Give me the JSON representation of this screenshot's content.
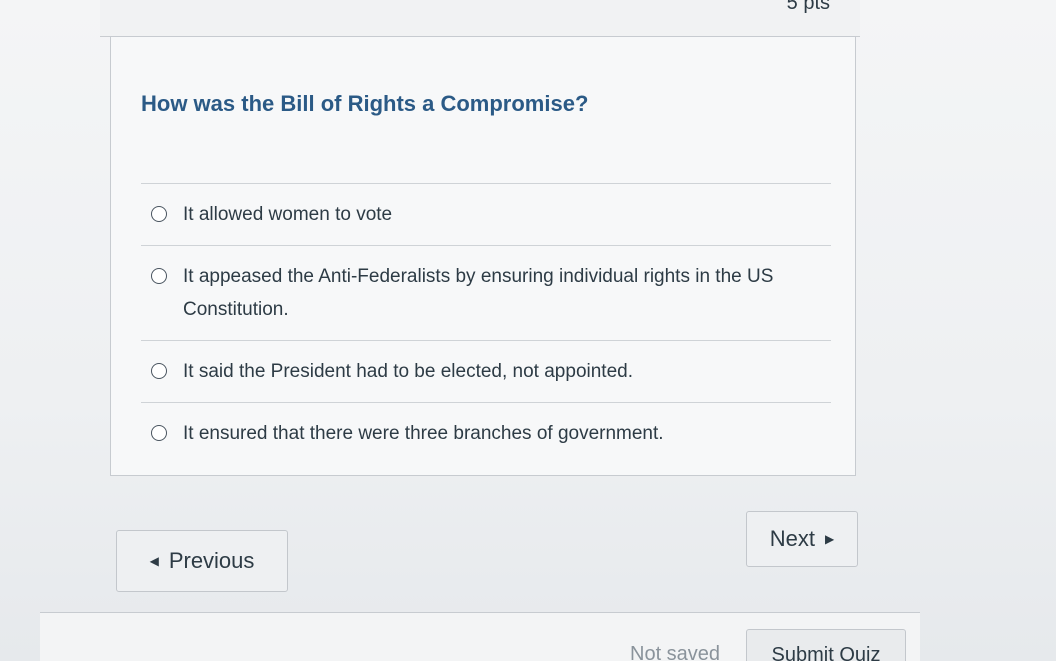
{
  "question": {
    "points": "5 pts",
    "text": "How was the Bill of Rights a Compromise?",
    "answers": [
      {
        "label": "It allowed women to vote"
      },
      {
        "label": "It appeased the Anti-Federalists by ensuring individual rights in the US Constitution."
      },
      {
        "label": "It said the President had to be elected, not appointed."
      },
      {
        "label": "It ensured that there were three branches of government."
      }
    ]
  },
  "navigation": {
    "previous_label": "Previous",
    "next_label": "Next"
  },
  "footer": {
    "status_text": "Not saved",
    "submit_label": "Submit Quiz"
  }
}
